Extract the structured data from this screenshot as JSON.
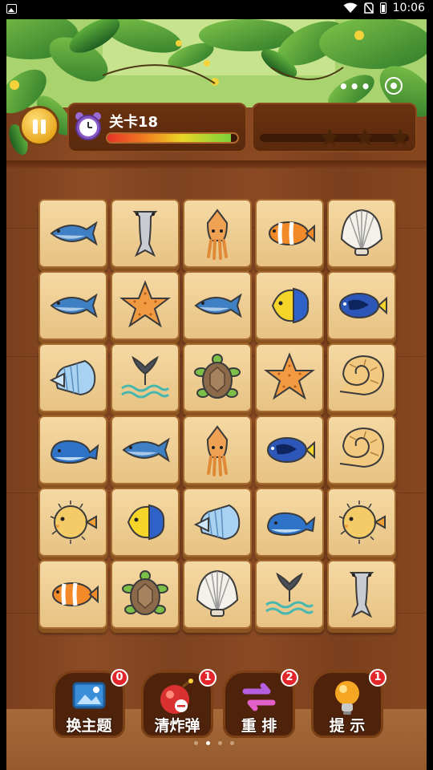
{
  "status_bar": {
    "time": "10:06"
  },
  "header": {
    "level_label": "关卡18",
    "progress": 0.95,
    "stars_total": 3,
    "capsule_dots": "•••"
  },
  "board": {
    "rows": [
      [
        "tuna",
        "shark",
        "squid",
        "clownfish",
        "shell"
      ],
      [
        "tuna",
        "starfish",
        "tuna",
        "angelfish",
        "surgeonfish"
      ],
      [
        "conch",
        "whale-tail",
        "turtle",
        "starfish",
        "ammonite"
      ],
      [
        "whale",
        "tuna",
        "squid",
        "surgeonfish",
        "ammonite"
      ],
      [
        "pufferfish",
        "angelfish",
        "conch",
        "whale",
        "pufferfish"
      ],
      [
        "clownfish",
        "turtle",
        "shell",
        "whale-tail",
        "shark"
      ]
    ]
  },
  "tools": [
    {
      "label": "换主题",
      "count": "0",
      "icon": "picture-icon"
    },
    {
      "label": "清炸弹",
      "count": "1",
      "icon": "bomb-icon"
    },
    {
      "label": "重 排",
      "count": "2",
      "icon": "shuffle-icon"
    },
    {
      "label": "提 示",
      "count": "1",
      "icon": "bulb-icon"
    }
  ],
  "pager": {
    "pages": 4,
    "active": 1
  },
  "colors": {
    "tile": "#f0d39a",
    "wood": "#7d4220",
    "badge": "#e3262b"
  }
}
